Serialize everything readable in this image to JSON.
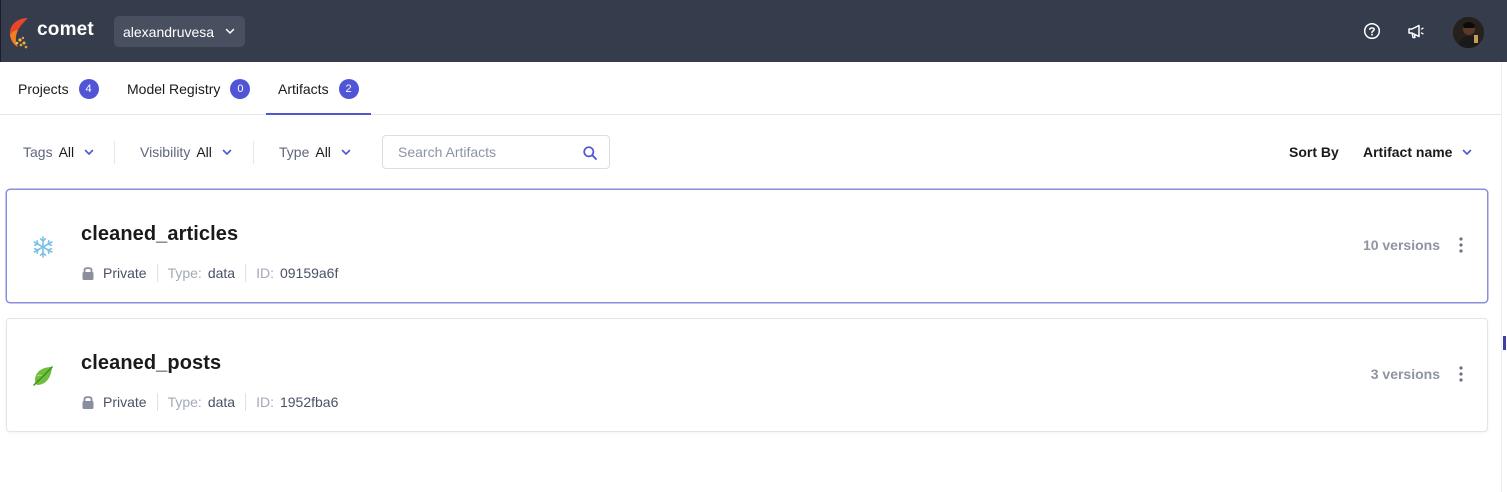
{
  "header": {
    "brand": "comet",
    "workspace": "alexandruvesa",
    "icons": [
      "help-icon",
      "announcements-icon",
      "user-avatar"
    ]
  },
  "tabs": [
    {
      "label": "Projects",
      "count": "4",
      "active": false
    },
    {
      "label": "Model Registry",
      "count": "0",
      "active": false
    },
    {
      "label": "Artifacts",
      "count": "2",
      "active": true
    }
  ],
  "filters": {
    "tags": {
      "label": "Tags",
      "value": "All"
    },
    "visibility": {
      "label": "Visibility",
      "value": "All"
    },
    "type": {
      "label": "Type",
      "value": "All"
    },
    "search_placeholder": "Search Artifacts",
    "sort_label": "Sort By",
    "sort_value": "Artifact name"
  },
  "artifacts": [
    {
      "name": "cleaned_articles",
      "icon": "snowflake-icon",
      "visibility": "Private",
      "type_label": "Type:",
      "type": "data",
      "id_label": "ID:",
      "id": "09159a6f",
      "versions": "10 versions",
      "selected": true
    },
    {
      "name": "cleaned_posts",
      "icon": "leaf-icon",
      "visibility": "Private",
      "type_label": "Type:",
      "type": "data",
      "id_label": "ID:",
      "id": "1952fba6",
      "versions": "3 versions",
      "selected": false
    }
  ],
  "colors": {
    "topbar": "#353c4c",
    "accent": "#5055d6",
    "card_selected_border": "#8a8edf"
  }
}
